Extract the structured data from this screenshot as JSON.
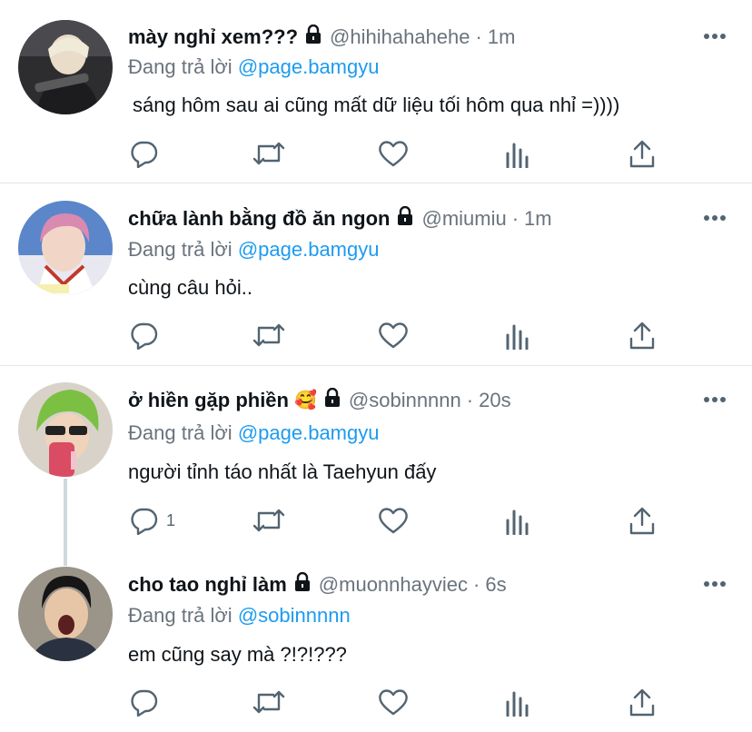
{
  "tweets": [
    {
      "name": "mày nghỉ xem???",
      "handle": "@hihihahahehe",
      "time": "1m",
      "replying_label": "Đang trả lời",
      "replying_to": "@page.bamgyu",
      "text": "sáng hôm sau ai cũng mất dữ liệu tối hôm qua nhỉ =))))",
      "reply_count": "",
      "emoji": ""
    },
    {
      "name": "chữa lành bằng đồ ăn ngon",
      "handle": "@miumiu",
      "time": "1m",
      "replying_label": "Đang trả lời",
      "replying_to": "@page.bamgyu",
      "text": "cùng câu hỏi..",
      "reply_count": "",
      "emoji": ""
    },
    {
      "name": "ở hiền gặp phiền",
      "handle": "@sobinnnnn",
      "time": "20s",
      "replying_label": "Đang trả lời",
      "replying_to": "@page.bamgyu",
      "text": "người tỉnh táo nhất là Taehyun đấy",
      "reply_count": "1",
      "emoji": "🥰"
    },
    {
      "name": "cho tao nghỉ làm",
      "handle": "@muonnhayviec",
      "time": "6s",
      "replying_label": "Đang trả lời",
      "replying_to": "@sobinnnnn",
      "text": "em cũng say mà ?!?!???",
      "reply_count": "",
      "emoji": ""
    }
  ],
  "icons": {
    "reply": "reply-icon",
    "retweet": "retweet-icon",
    "like": "heart-icon",
    "analytics": "analytics-icon",
    "share": "share-icon",
    "lock": "lock-icon",
    "more": "more-icon"
  },
  "colors": {
    "text": "#0f1419",
    "secondary": "#6a737d",
    "mention": "#1d9bf0",
    "icon": "#536471",
    "divider": "#e6e6e6",
    "thread_line": "#cfd9de"
  }
}
